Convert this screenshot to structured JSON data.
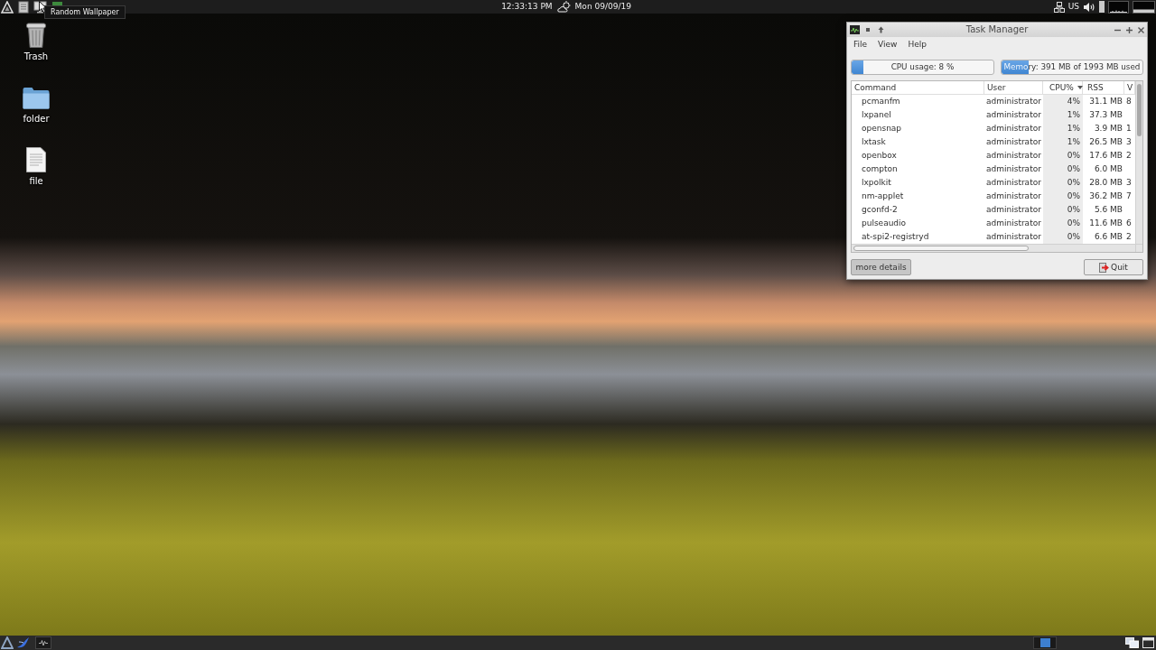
{
  "top_panel": {
    "tooltip": "Random Wallpaper",
    "clock": "12:33:13 PM",
    "date": "Mon 09/09/19",
    "keyboard_layout": "US"
  },
  "desktop_icons": [
    {
      "kind": "trash",
      "label": "Trash"
    },
    {
      "kind": "folder",
      "label": "folder"
    },
    {
      "kind": "file",
      "label": "file"
    }
  ],
  "task_manager": {
    "title": "Task Manager",
    "menu": [
      "File",
      "View",
      "Help"
    ],
    "cpu_meter": {
      "label": "CPU usage: 8 %",
      "level": 0.08
    },
    "memory_meter": {
      "label": "Memory: 391 MB of 1993 MB used",
      "level": 0.19
    },
    "table": {
      "columns": [
        {
          "label": "Command",
          "sorted": false
        },
        {
          "label": "User",
          "sorted": false
        },
        {
          "label": "CPU%",
          "sorted": true
        },
        {
          "label": "RSS",
          "sorted": false
        },
        {
          "label": "V",
          "sorted": false
        }
      ],
      "rows": [
        {
          "command": "pcmanfm",
          "user": "administrator",
          "cpu": "4%",
          "rss": "31.1 MB",
          "column_5": "8"
        },
        {
          "command": "lxpanel",
          "user": "administrator",
          "cpu": "1%",
          "rss": "37.3 MB"
        },
        {
          "command": "opensnap",
          "user": "administrator",
          "cpu": "1%",
          "rss": "3.9 MB",
          "column_5": "1"
        },
        {
          "command": "lxtask",
          "user": "administrator",
          "cpu": "1%",
          "rss": "26.5 MB",
          "column_5": "3"
        },
        {
          "command": "openbox",
          "user": "administrator",
          "cpu": "0%",
          "rss": "17.6 MB",
          "column_5": "2"
        },
        {
          "command": "compton",
          "user": "administrator",
          "cpu": "0%",
          "rss": "6.0 MB"
        },
        {
          "command": "lxpolkit",
          "user": "administrator",
          "cpu": "0%",
          "rss": "28.0 MB",
          "column_5": "3"
        },
        {
          "command": "nm-applet",
          "user": "administrator",
          "cpu": "0%",
          "rss": "36.2 MB",
          "column_5": "7"
        },
        {
          "command": "gconfd-2",
          "user": "administrator",
          "cpu": "0%",
          "rss": "5.6 MB"
        },
        {
          "command": "pulseaudio",
          "user": "administrator",
          "cpu": "0%",
          "rss": "11.6 MB",
          "column_5": "6"
        },
        {
          "command": "at-spi2-registryd",
          "user": "administrator",
          "cpu": "0%",
          "rss": "6.6 MB",
          "column_5": "2"
        }
      ]
    },
    "buttons": {
      "details": "more details",
      "quit": "Quit"
    }
  }
}
